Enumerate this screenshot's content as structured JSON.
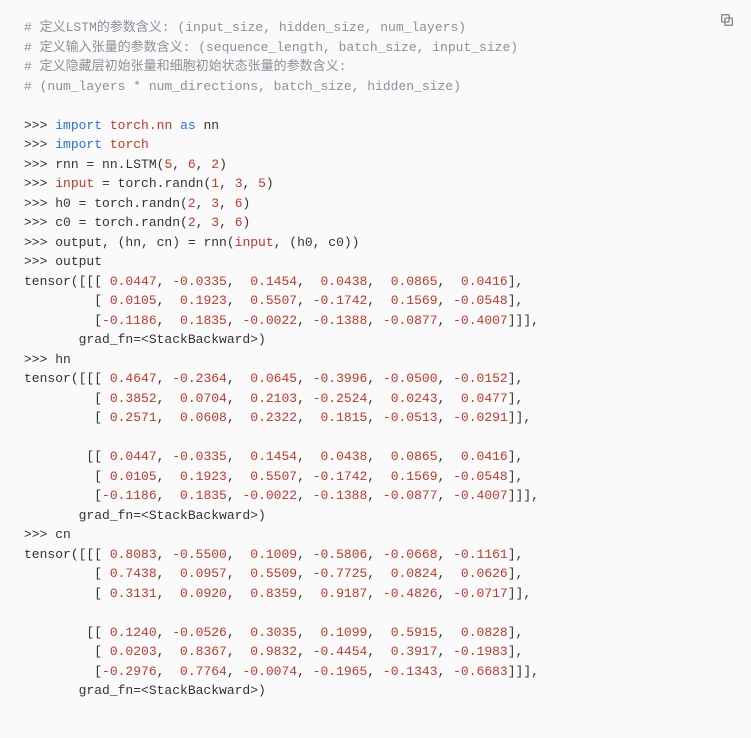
{
  "copy_label": "Copy",
  "lines": {
    "l01": "# 定义LSTM的参数含义: (input_size, hidden_size, num_layers)",
    "l02": "# 定义输入张量的参数含义: (sequence_length, batch_size, input_size)",
    "l03": "# 定义隐藏层初始张量和细胞初始状态张量的参数含义:",
    "l04": "# (num_layers * num_directions, batch_size, hidden_size)",
    "l05": "",
    "p": ">>> ",
    "import_kw": "import",
    "as_kw": "as",
    "torch_nn": "torch.nn",
    "nn": "nn",
    "torch": "torch",
    "rnn_lhs": "rnn = nn.LSTM(",
    "n5": "5",
    "n6": "6",
    "n2": "2",
    "n1": "1",
    "n3": "3",
    "input_lhs": "input",
    "eq_randn": " = torch.randn(",
    "h0_lhs": "h0 = torch.randn(",
    "c0_lhs": "c0 = torch.randn(",
    "call_line": "output, (hn, cn) = rnn(",
    "call_args": "input",
    "call_rest": ", (h0, c0))",
    "out_word": "output",
    "hn_word": "hn",
    "cn_word": "cn",
    "tensor_pre": "tensor([[[ ",
    "row_open9": "         [ ",
    "row_open9n": "         [",
    "row_open8": "        [[ ",
    "grad_line": "       grad_fn=<StackBackward>)",
    "out_r1": [
      "0.0447",
      "-0.0335",
      "0.1454",
      "0.0438",
      "0.0865",
      "0.0416"
    ],
    "out_r2": [
      "0.0105",
      "0.1923",
      "0.5507",
      "-0.1742",
      "0.1569",
      "-0.0548"
    ],
    "out_r3": [
      "-0.1186",
      "0.1835",
      "-0.0022",
      "-0.1388",
      "-0.0877",
      "-0.4007"
    ],
    "hn_b1r1": [
      "0.4647",
      "-0.2364",
      "0.0645",
      "-0.3996",
      "-0.0500",
      "-0.0152"
    ],
    "hn_b1r2": [
      "0.3852",
      "0.0704",
      "0.2103",
      "-0.2524",
      "0.0243",
      "0.0477"
    ],
    "hn_b1r3": [
      "0.2571",
      "0.0608",
      "0.2322",
      "0.1815",
      "-0.0513",
      "-0.0291"
    ],
    "hn_b2r1": [
      "0.0447",
      "-0.0335",
      "0.1454",
      "0.0438",
      "0.0865",
      "0.0416"
    ],
    "hn_b2r2": [
      "0.0105",
      "0.1923",
      "0.5507",
      "-0.1742",
      "0.1569",
      "-0.0548"
    ],
    "hn_b2r3": [
      "-0.1186",
      "0.1835",
      "-0.0022",
      "-0.1388",
      "-0.0877",
      "-0.4007"
    ],
    "cn_b1r1": [
      "0.8083",
      "-0.5500",
      "0.1009",
      "-0.5806",
      "-0.0668",
      "-0.1161"
    ],
    "cn_b1r2": [
      "0.7438",
      "0.0957",
      "0.5509",
      "-0.7725",
      "0.0824",
      "0.0626"
    ],
    "cn_b1r3": [
      "0.3131",
      "0.0920",
      "0.8359",
      "0.9187",
      "-0.4826",
      "-0.0717"
    ],
    "cn_b2r1": [
      "0.1240",
      "-0.0526",
      "0.3035",
      "0.1099",
      "0.5915",
      "0.0828"
    ],
    "cn_b2r2": [
      "0.0203",
      "0.8367",
      "0.9832",
      "-0.4454",
      "0.3917",
      "-0.1983"
    ],
    "cn_b2r3": [
      "-0.2976",
      "0.7764",
      "-0.0074",
      "-0.1965",
      "-0.1343",
      "-0.6683"
    ]
  }
}
